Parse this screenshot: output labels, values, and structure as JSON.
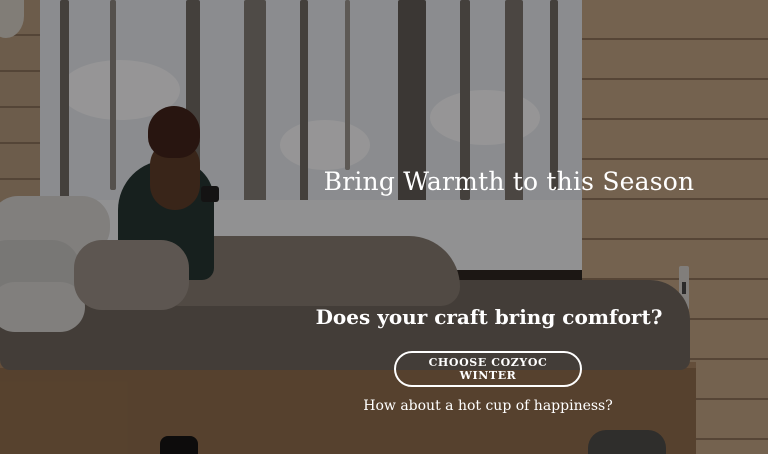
{
  "hero": {
    "title": "Bring Warmth to this Season",
    "question": "Does your craft bring comfort?",
    "cta_label": "CHOOSE COZYOC WINTER",
    "subtitle": "How about a hot cup of happiness?"
  },
  "colors": {
    "text": "#ffffff",
    "overlay": "rgba(10, 8, 6, 0.42)"
  }
}
